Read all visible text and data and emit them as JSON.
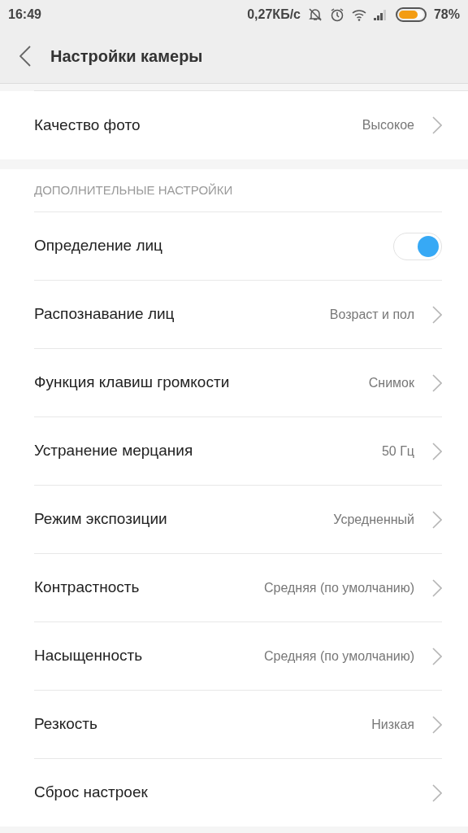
{
  "status_bar": {
    "time": "16:49",
    "speed": "0,27КБ/с",
    "battery": {
      "level": 0.78,
      "percent": "78%"
    }
  },
  "header": {
    "title": "Настройки камеры"
  },
  "top_rows": [
    {
      "kind": "link",
      "label": "Качество фото",
      "value": "Высокое"
    }
  ],
  "section": {
    "title": "ДОПОЛНИТЕЛЬНЫЕ НАСТРОЙКИ",
    "rows": [
      {
        "kind": "switch",
        "label": "Определение лиц",
        "on": true
      },
      {
        "kind": "link",
        "label": "Распознавание лиц",
        "value": "Возраст и пол"
      },
      {
        "kind": "link",
        "label": "Функция клавиш громкости",
        "value": "Снимок"
      },
      {
        "kind": "link",
        "label": "Устранение мерцания",
        "value": "50 Гц"
      },
      {
        "kind": "link",
        "label": "Режим экспозиции",
        "value": "Усредненный"
      },
      {
        "kind": "link",
        "label": "Контрастность",
        "value": "Средняя (по умолчанию)"
      },
      {
        "kind": "link",
        "label": "Насыщенность",
        "value": "Средняя (по умолчанию)"
      },
      {
        "kind": "link",
        "label": "Резкость",
        "value": "Низкая"
      },
      {
        "kind": "link",
        "label": "Сброс настроек"
      }
    ]
  }
}
